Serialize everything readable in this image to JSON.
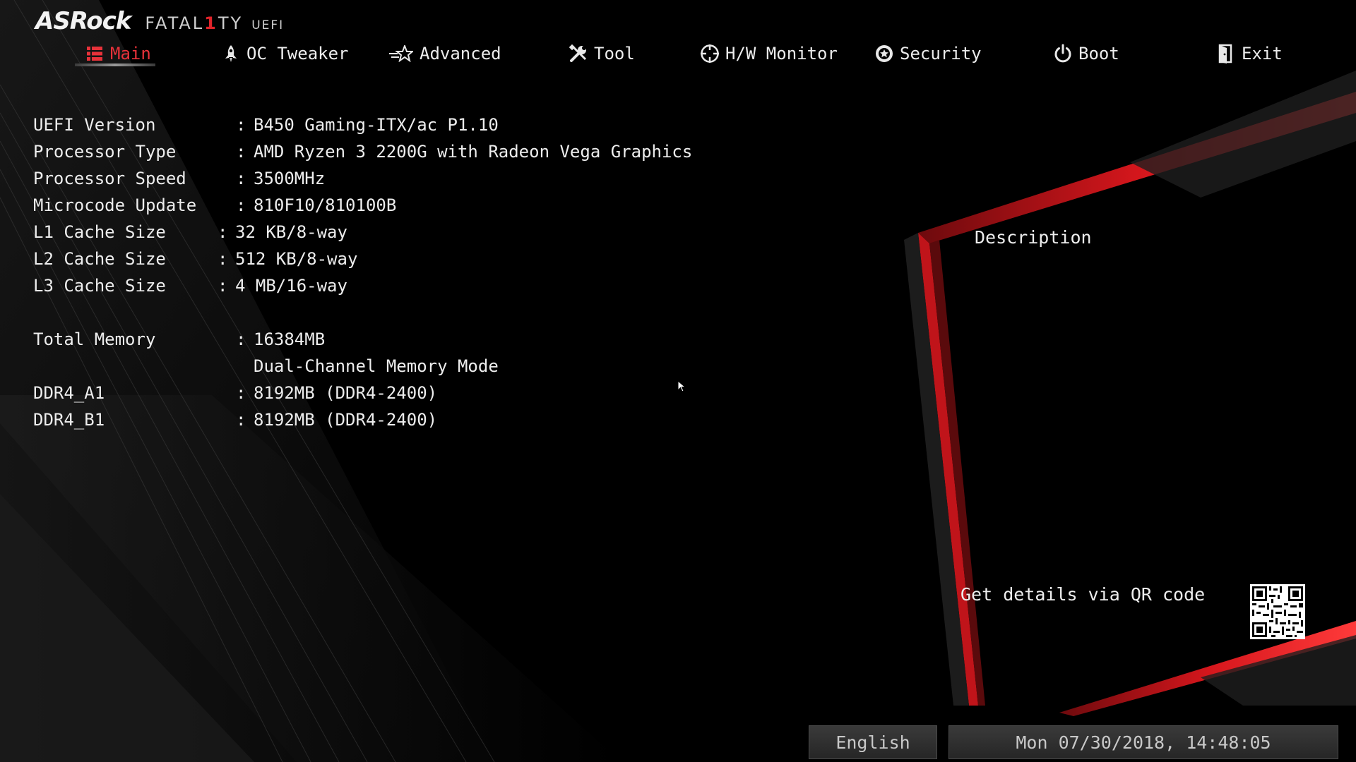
{
  "brand": {
    "asrock": "ASRock",
    "fatal_pre": "FATAL",
    "fatal_one": "1",
    "fatal_post": "TY",
    "uefi": "UEFI"
  },
  "nav": {
    "main": "Main",
    "oc_tweaker": "OC Tweaker",
    "advanced": "Advanced",
    "tool": "Tool",
    "hw_monitor": "H/W Monitor",
    "security": "Security",
    "boot": "Boot",
    "exit": "Exit"
  },
  "info": {
    "uefi_version": {
      "label": "UEFI Version",
      "value": "B450 Gaming-ITX/ac P1.10"
    },
    "processor_type": {
      "label": "Processor Type",
      "value": "AMD Ryzen 3 2200G with Radeon Vega Graphics"
    },
    "processor_speed": {
      "label": "Processor Speed",
      "value": "3500MHz"
    },
    "microcode_update": {
      "label": "Microcode Update",
      "value": "810F10/810100B"
    },
    "l1_cache": {
      "label": "L1 Cache Size",
      "value": "32 KB/8-way"
    },
    "l2_cache": {
      "label": "L2 Cache Size",
      "value": "512 KB/8-way"
    },
    "l3_cache": {
      "label": "L3 Cache Size",
      "value": "4 MB/16-way"
    },
    "total_memory": {
      "label": "Total Memory",
      "value": "16384MB"
    },
    "memory_mode": {
      "value": "Dual-Channel Memory Mode"
    },
    "ddr4_a1": {
      "label": "DDR4_A1",
      "value": "8192MB (DDR4-2400)"
    },
    "ddr4_b1": {
      "label": "DDR4_B1",
      "value": "8192MB (DDR4-2400)"
    },
    "colon": ":"
  },
  "description": {
    "title": "Description",
    "qr_text": "Get details via QR code"
  },
  "footer": {
    "language": "English",
    "datetime": "Mon 07/30/2018, 14:48:05"
  },
  "colors": {
    "accent": "#e0242a",
    "background": "#000000",
    "text": "#ececec"
  },
  "icons": {
    "main": "list-icon",
    "oc_tweaker": "rocket-icon",
    "advanced": "star-icon",
    "tool": "wrench-icon",
    "hw_monitor": "crosshair-icon",
    "security": "shield-icon",
    "boot": "power-icon",
    "exit": "door-icon"
  }
}
